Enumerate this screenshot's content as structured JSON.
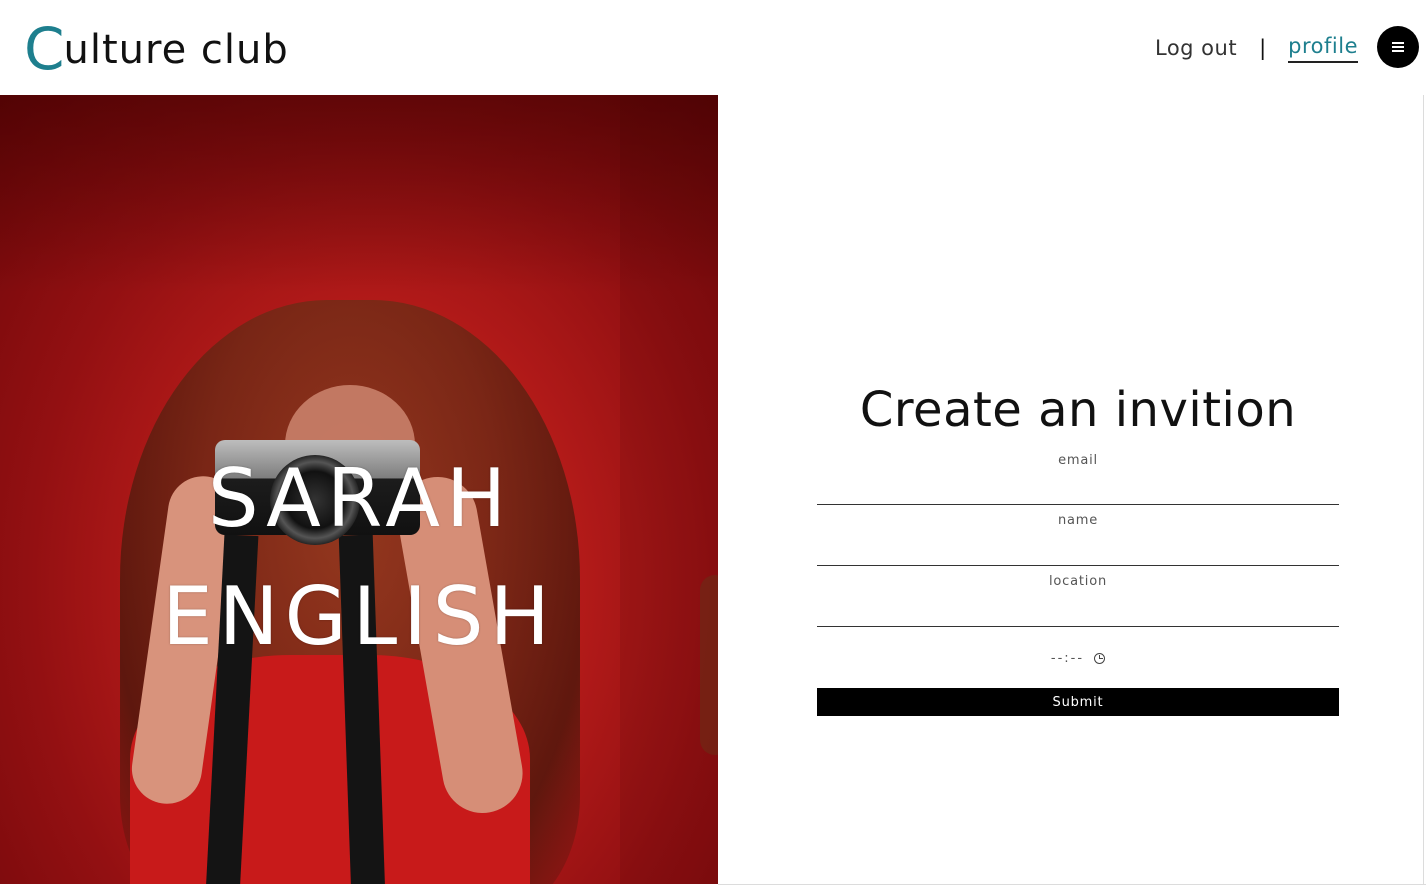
{
  "header": {
    "logo_initial": "C",
    "logo_rest": "ulture club",
    "nav": {
      "logout_label": "Log out",
      "separator": "|",
      "profile_label": "profile"
    },
    "menu_icon": "hamburger-icon"
  },
  "hero": {
    "first_name": "SARAH",
    "last_name": "ENGLISH"
  },
  "form": {
    "title": "Create an invition",
    "email_placeholder": "email",
    "name_placeholder": "name",
    "location_placeholder": "location",
    "time_placeholder": "--:--",
    "time_icon": "clock-icon",
    "submit_label": "Submit"
  },
  "colors": {
    "accent": "#1e7f8e",
    "hero_red": "#b81c1a",
    "button_bg": "#000000"
  }
}
